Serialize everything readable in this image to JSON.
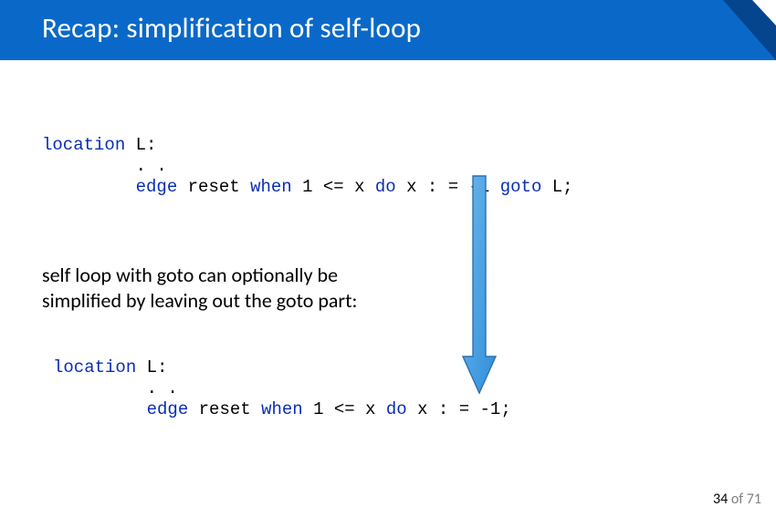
{
  "header": {
    "title": "Recap: simplification of self-loop"
  },
  "code1": {
    "kw_location": "location",
    "l_colon": " L:",
    "dots": "         . .",
    "indent": "         ",
    "kw_edge": "edge",
    "sp1": " reset ",
    "kw_when": "when",
    "cond": " 1 <= x ",
    "kw_do": "do",
    "assign": " x : = -1 ",
    "kw_goto": "goto",
    "tail": " L;"
  },
  "para": {
    "line1": "self loop with goto can optionally be",
    "line2": "simplified by leaving out the goto part:"
  },
  "code2": {
    "kw_location": "location",
    "l_colon": " L:",
    "dots": "         . .",
    "indent": "         ",
    "kw_edge": "edge",
    "sp1": " reset ",
    "kw_when": "when",
    "cond": " 1 <= x ",
    "kw_do": "do",
    "assign": " x : = -1;",
    "kw_goto": "",
    "tail": ""
  },
  "arrow": {
    "fill": "#49a0e5",
    "stroke": "#3176b5"
  },
  "page": {
    "current": "34",
    "sep": " of ",
    "total": "71"
  }
}
